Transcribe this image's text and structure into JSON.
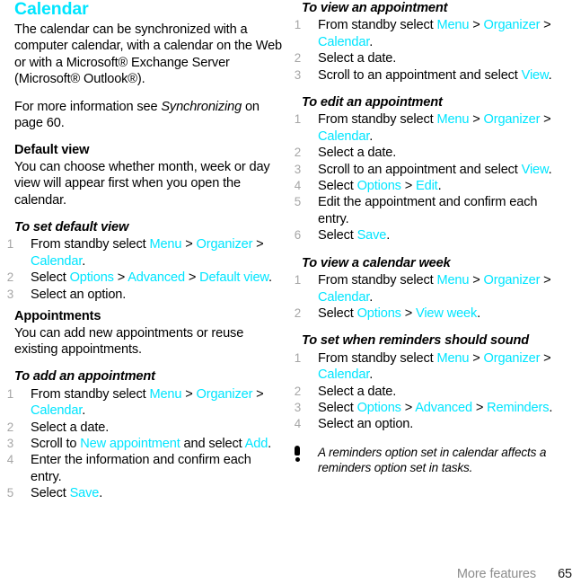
{
  "document": {
    "title": "Calendar",
    "footer": {
      "section": "More features",
      "page_number": "65"
    },
    "accent_color": "#00e5ff",
    "step_number_color": "#a6a6a6",
    "footer_color": "#8c8c8c"
  },
  "left_column": {
    "intro": "The calendar can be synchronized with a computer calendar, with a calendar on the Web or with a Microsoft® Exchange Server (Microsoft® Outlook®).",
    "cross_reference": {
      "lead": "For more information see ",
      "italic_ref": "Synchronizing",
      "tail": " on page 60."
    },
    "default_view": {
      "heading": "Default view",
      "body": "You can choose whether month, week or day view will appear first when you open the calendar."
    },
    "to_set_default_view": {
      "heading": "To set default view",
      "steps": [
        {
          "num": "1",
          "parts": [
            {
              "t": "From standby select ",
              "k": "plain"
            },
            {
              "t": "Menu",
              "k": "link"
            },
            {
              "t": " > ",
              "k": "plain"
            },
            {
              "t": "Organizer",
              "k": "link"
            },
            {
              "t": " > ",
              "k": "plain"
            },
            {
              "t": "Calendar",
              "k": "link"
            },
            {
              "t": ".",
              "k": "plain"
            }
          ]
        },
        {
          "num": "2",
          "parts": [
            {
              "t": "Select ",
              "k": "plain"
            },
            {
              "t": "Options",
              "k": "link"
            },
            {
              "t": " > ",
              "k": "plain"
            },
            {
              "t": "Advanced",
              "k": "link"
            },
            {
              "t": " > ",
              "k": "plain"
            },
            {
              "t": "Default view",
              "k": "link"
            },
            {
              "t": ".",
              "k": "plain"
            }
          ]
        },
        {
          "num": "3",
          "parts": [
            {
              "t": "Select an option.",
              "k": "plain"
            }
          ]
        }
      ]
    },
    "appointments": {
      "heading": "Appointments",
      "body": "You can add new appointments or reuse existing appointments."
    },
    "to_add_an_appointment": {
      "heading": "To add an appointment",
      "steps": [
        {
          "num": "1",
          "parts": [
            {
              "t": "From standby select ",
              "k": "plain"
            },
            {
              "t": "Menu",
              "k": "link"
            },
            {
              "t": " > ",
              "k": "plain"
            },
            {
              "t": "Organizer",
              "k": "link"
            },
            {
              "t": " > ",
              "k": "plain"
            },
            {
              "t": "Calendar",
              "k": "link"
            },
            {
              "t": ".",
              "k": "plain"
            }
          ]
        },
        {
          "num": "2",
          "parts": [
            {
              "t": "Select a date.",
              "k": "plain"
            }
          ]
        },
        {
          "num": "3",
          "parts": [
            {
              "t": "Scroll to ",
              "k": "plain"
            },
            {
              "t": "New appointment",
              "k": "link"
            },
            {
              "t": " and select ",
              "k": "plain"
            },
            {
              "t": "Add",
              "k": "link"
            },
            {
              "t": ".",
              "k": "plain"
            }
          ]
        },
        {
          "num": "4",
          "parts": [
            {
              "t": "Enter the information and confirm each entry.",
              "k": "plain"
            }
          ]
        },
        {
          "num": "5",
          "parts": [
            {
              "t": "Select ",
              "k": "plain"
            },
            {
              "t": "Save",
              "k": "link"
            },
            {
              "t": ".",
              "k": "plain"
            }
          ]
        }
      ]
    }
  },
  "right_column": {
    "to_view_an_appointment": {
      "heading": "To view an appointment",
      "steps": [
        {
          "num": "1",
          "parts": [
            {
              "t": "From standby select ",
              "k": "plain"
            },
            {
              "t": "Menu",
              "k": "link"
            },
            {
              "t": " > ",
              "k": "plain"
            },
            {
              "t": "Organizer",
              "k": "link"
            },
            {
              "t": " > ",
              "k": "plain"
            },
            {
              "t": "Calendar",
              "k": "link"
            },
            {
              "t": ".",
              "k": "plain"
            }
          ]
        },
        {
          "num": "2",
          "parts": [
            {
              "t": "Select a date.",
              "k": "plain"
            }
          ]
        },
        {
          "num": "3",
          "parts": [
            {
              "t": "Scroll to an appointment and select ",
              "k": "plain"
            },
            {
              "t": "View",
              "k": "link"
            },
            {
              "t": ".",
              "k": "plain"
            }
          ]
        }
      ]
    },
    "to_edit_an_appointment": {
      "heading": "To edit an appointment",
      "steps": [
        {
          "num": "1",
          "parts": [
            {
              "t": "From standby select ",
              "k": "plain"
            },
            {
              "t": "Menu",
              "k": "link"
            },
            {
              "t": " > ",
              "k": "plain"
            },
            {
              "t": "Organizer",
              "k": "link"
            },
            {
              "t": " > ",
              "k": "plain"
            },
            {
              "t": "Calendar",
              "k": "link"
            },
            {
              "t": ".",
              "k": "plain"
            }
          ]
        },
        {
          "num": "2",
          "parts": [
            {
              "t": "Select a date.",
              "k": "plain"
            }
          ]
        },
        {
          "num": "3",
          "parts": [
            {
              "t": "Scroll to an appointment and select ",
              "k": "plain"
            },
            {
              "t": "View",
              "k": "link"
            },
            {
              "t": ".",
              "k": "plain"
            }
          ]
        },
        {
          "num": "4",
          "parts": [
            {
              "t": "Select ",
              "k": "plain"
            },
            {
              "t": "Options",
              "k": "link"
            },
            {
              "t": " > ",
              "k": "plain"
            },
            {
              "t": "Edit",
              "k": "link"
            },
            {
              "t": ".",
              "k": "plain"
            }
          ]
        },
        {
          "num": "5",
          "parts": [
            {
              "t": "Edit the appointment and confirm each entry.",
              "k": "plain"
            }
          ]
        },
        {
          "num": "6",
          "parts": [
            {
              "t": "Select ",
              "k": "plain"
            },
            {
              "t": "Save",
              "k": "link"
            },
            {
              "t": ".",
              "k": "plain"
            }
          ]
        }
      ]
    },
    "to_view_a_calendar_week": {
      "heading": "To view a calendar week",
      "steps": [
        {
          "num": "1",
          "parts": [
            {
              "t": "From standby select ",
              "k": "plain"
            },
            {
              "t": "Menu",
              "k": "link"
            },
            {
              "t": " > ",
              "k": "plain"
            },
            {
              "t": "Organizer",
              "k": "link"
            },
            {
              "t": " > ",
              "k": "plain"
            },
            {
              "t": "Calendar",
              "k": "link"
            },
            {
              "t": ".",
              "k": "plain"
            }
          ]
        },
        {
          "num": "2",
          "parts": [
            {
              "t": "Select ",
              "k": "plain"
            },
            {
              "t": "Options",
              "k": "link"
            },
            {
              "t": " > ",
              "k": "plain"
            },
            {
              "t": "View week",
              "k": "link"
            },
            {
              "t": ".",
              "k": "plain"
            }
          ]
        }
      ]
    },
    "to_set_when_reminders_should_sound": {
      "heading": "To set when reminders should sound",
      "steps": [
        {
          "num": "1",
          "parts": [
            {
              "t": "From standby select ",
              "k": "plain"
            },
            {
              "t": "Menu",
              "k": "link"
            },
            {
              "t": " > ",
              "k": "plain"
            },
            {
              "t": "Organizer",
              "k": "link"
            },
            {
              "t": " > ",
              "k": "plain"
            },
            {
              "t": "Calendar",
              "k": "link"
            },
            {
              "t": ".",
              "k": "plain"
            }
          ]
        },
        {
          "num": "2",
          "parts": [
            {
              "t": "Select a date.",
              "k": "plain"
            }
          ]
        },
        {
          "num": "3",
          "parts": [
            {
              "t": "Select ",
              "k": "plain"
            },
            {
              "t": "Options",
              "k": "link"
            },
            {
              "t": " > ",
              "k": "plain"
            },
            {
              "t": "Advanced",
              "k": "link"
            },
            {
              "t": " > ",
              "k": "plain"
            },
            {
              "t": "Reminders",
              "k": "link"
            },
            {
              "t": ".",
              "k": "plain"
            }
          ]
        },
        {
          "num": "4",
          "parts": [
            {
              "t": "Select an option.",
              "k": "plain"
            }
          ]
        }
      ]
    },
    "note": {
      "icon": "exclamation-icon",
      "text": "A reminders option set in calendar affects a reminders option set in tasks."
    }
  }
}
